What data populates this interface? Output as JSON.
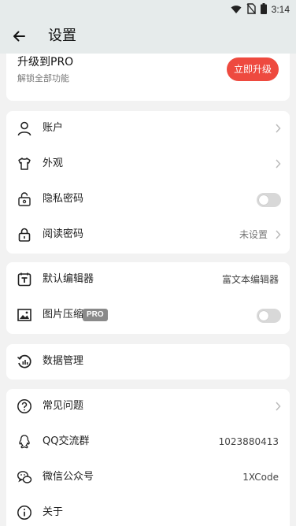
{
  "status_bar": {
    "time": "3:14",
    "icons": [
      "wifi-icon",
      "no-sim-icon",
      "battery-icon"
    ]
  },
  "header": {
    "title": "设置",
    "back_icon": "arrow-left-icon"
  },
  "upgrade": {
    "title": "升级到PRO",
    "subtitle": "解锁全部功能",
    "button_label": "立即升级",
    "button_color": "#ee4a3f"
  },
  "group1": {
    "account": {
      "label": "账户",
      "icon": "person-icon"
    },
    "appearance": {
      "label": "外观",
      "icon": "tshirt-icon"
    },
    "privacy_password": {
      "label": "隐私密码",
      "icon": "privacy-lock-icon",
      "toggle_on": false
    },
    "reading_password": {
      "label": "阅读密码",
      "icon": "lock-icon",
      "value": "未设置"
    }
  },
  "group2": {
    "default_editor": {
      "label": "默认编辑器",
      "icon": "text-editor-icon",
      "value": "富文本编辑器"
    },
    "image_compress": {
      "label": "图片压缩",
      "badge": "PRO",
      "icon": "image-icon",
      "toggle_on": false
    }
  },
  "group3": {
    "data_management": {
      "label": "数据管理",
      "icon": "data-history-icon"
    }
  },
  "group4": {
    "faq": {
      "label": "常见问题",
      "icon": "help-circle-icon"
    },
    "qq_group": {
      "label": "QQ交流群",
      "icon": "qq-icon",
      "value": "1023880413"
    },
    "wechat": {
      "label": "微信公众号",
      "icon": "wechat-icon",
      "value": "1XCode"
    },
    "about": {
      "label": "关于",
      "icon": "info-icon"
    }
  },
  "colors": {
    "accent": "#ee4a3f",
    "appbar_bg": "#e6ebeb",
    "page_bg": "#f2f2f2",
    "toggle_off": "#d8d8d8"
  }
}
